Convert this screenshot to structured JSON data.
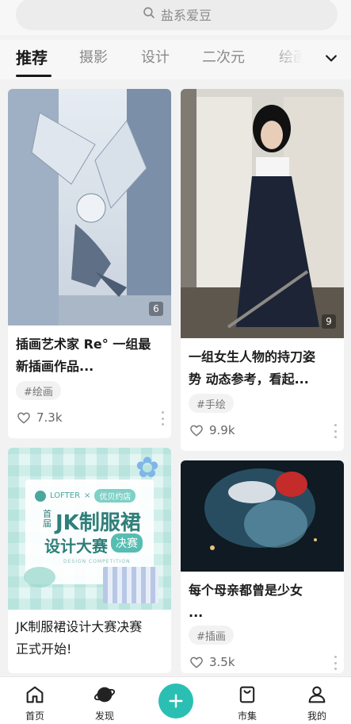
{
  "search": {
    "placeholder": "盐系爱豆"
  },
  "tabs": [
    {
      "label": "推荐",
      "active": true
    },
    {
      "label": "摄影"
    },
    {
      "label": "设计"
    },
    {
      "label": "二次元"
    },
    {
      "label": "绘画"
    }
  ],
  "feed": {
    "cards": [
      {
        "title": "插画艺术家 Re° 一组最新插画作品...",
        "title_line1": "插画艺术家 Re° 一组最",
        "title_line2": "新插画作品...",
        "image_count": "6",
        "tag": "#绘画",
        "likes": "7.3k"
      },
      {
        "title_line1": "一组女生人物的持刀姿",
        "title_line2": "势 动态参考，看起...",
        "image_count": "9",
        "tag": "#手绘",
        "likes": "9.9k"
      },
      {
        "title_line1": "JK制服裙设计大赛决赛",
        "title_line2": "正式开始!",
        "poster": {
          "brand": "LOFTER",
          "x": "×",
          "partner": "优贝约店",
          "line1_small": "首届",
          "line1_big": "JK制服裙",
          "line2": "设计大赛",
          "badge": "决赛",
          "sub": "DESIGN COMPETITION"
        }
      },
      {
        "title_line1": "每个母亲都曾是少女",
        "title_line2": "...",
        "tag": "#插画",
        "likes": "3.5k"
      }
    ]
  },
  "nav": [
    {
      "label": "首页",
      "icon": "home-icon"
    },
    {
      "label": "发现",
      "icon": "planet-icon"
    },
    {
      "label": "",
      "icon": "plus-icon"
    },
    {
      "label": "市集",
      "icon": "shopping-bag-icon"
    },
    {
      "label": "我的",
      "icon": "profile-icon"
    }
  ],
  "colors": {
    "accent": "#2bbfb3",
    "text_primary": "#1c1c1c",
    "text_secondary": "#8a8a8a"
  }
}
